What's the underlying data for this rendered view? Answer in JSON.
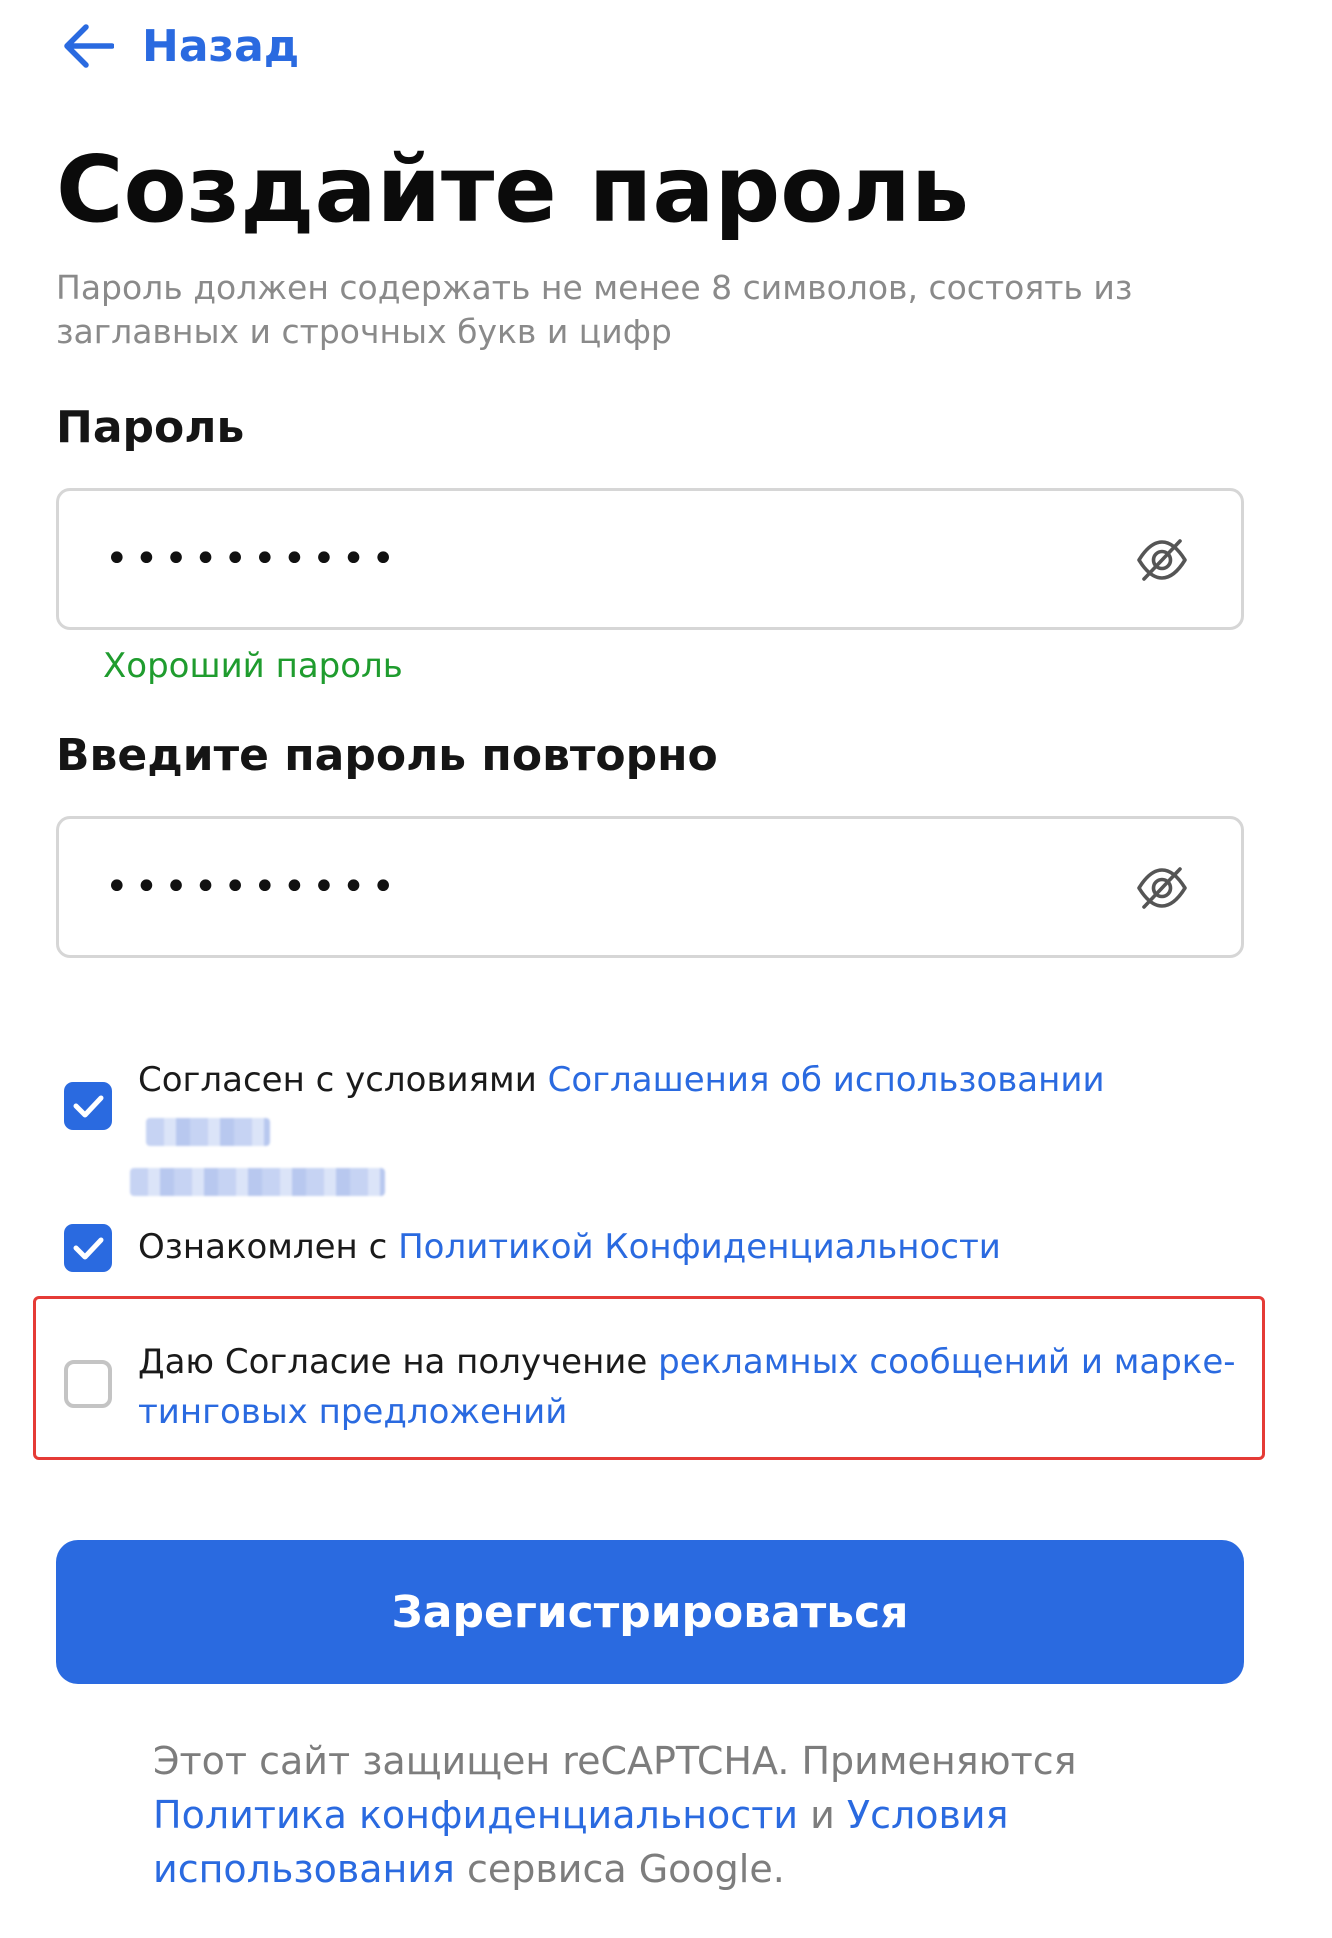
{
  "nav": {
    "back_label": "Назад"
  },
  "page": {
    "title": "Создайте пароль",
    "hint": "Пароль должен содержать не менее 8 символов, состоять из заглавных и строчных букв и цифр"
  },
  "password": {
    "label": "Пароль",
    "value": "••••••••••",
    "strength": "Хороший пароль"
  },
  "password_repeat": {
    "label": "Введите пароль повторно",
    "value": "••••••••••"
  },
  "consents": {
    "terms": {
      "checked": true,
      "text": "Согласен с условиями ",
      "link": "Соглашения об использовании"
    },
    "privacy": {
      "checked": true,
      "text": "Ознакомлен с ",
      "link": "Политикой Конфиденциальности"
    },
    "marketing": {
      "checked": false,
      "text": "Даю Согласие на получение ",
      "link_line1": "рекламных сообщений и марке-",
      "link_line2": "тинговых предложений"
    }
  },
  "submit": {
    "label": "Зарегистрироваться"
  },
  "footer": {
    "text1": "Этот сайт защищен reCAPTCHA. Применяются",
    "link1": "Политика конфиденциальности",
    "and": " и ",
    "link2_line1": "Условия",
    "link2_line2": "использования",
    "text2": " сервиса Google."
  },
  "colors": {
    "accent": "#2a6ae0",
    "success": "#1f9c2e",
    "highlight": "#e53b36",
    "hint": "#8a8a8a"
  },
  "icons": {
    "back": "arrow-left-icon",
    "visibility": "eye-slash-icon",
    "checkbox": "check-icon"
  }
}
